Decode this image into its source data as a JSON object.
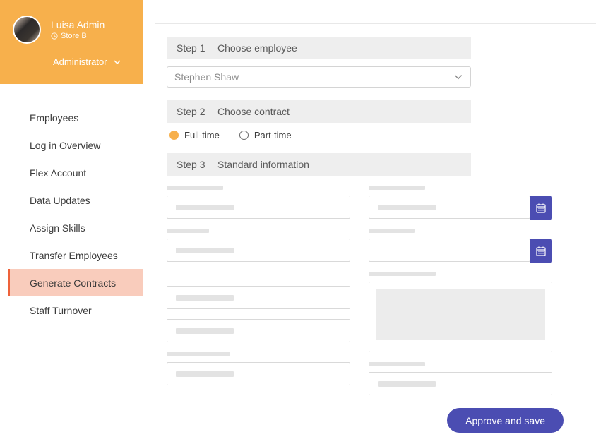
{
  "user": {
    "name": "Luisa Admin",
    "store": "Store B",
    "role": "Administrator"
  },
  "nav": {
    "items": [
      {
        "label": "Employees"
      },
      {
        "label": "Log in Overview"
      },
      {
        "label": "Flex Account"
      },
      {
        "label": "Data Updates"
      },
      {
        "label": "Assign Skills"
      },
      {
        "label": "Transfer Employees"
      },
      {
        "label": "Generate Contracts"
      },
      {
        "label": "Staff Turnover"
      }
    ],
    "active_index": 6
  },
  "steps": {
    "s1": {
      "num": "Step 1",
      "title": "Choose employee"
    },
    "s2": {
      "num": "Step 2",
      "title": "Choose contract"
    },
    "s3": {
      "num": "Step 3",
      "title": "Standard information"
    }
  },
  "employee_select": {
    "value": "Stephen Shaw"
  },
  "contract": {
    "options": [
      {
        "label": "Full-time",
        "selected": true
      },
      {
        "label": "Part-time",
        "selected": false
      }
    ]
  },
  "buttons": {
    "approve": "Approve and save"
  },
  "colors": {
    "accent_orange": "#f7b04c",
    "accent_salmon": "#f9ccbc",
    "accent_red": "#ee623a",
    "primary_indigo": "#4b4db2"
  }
}
